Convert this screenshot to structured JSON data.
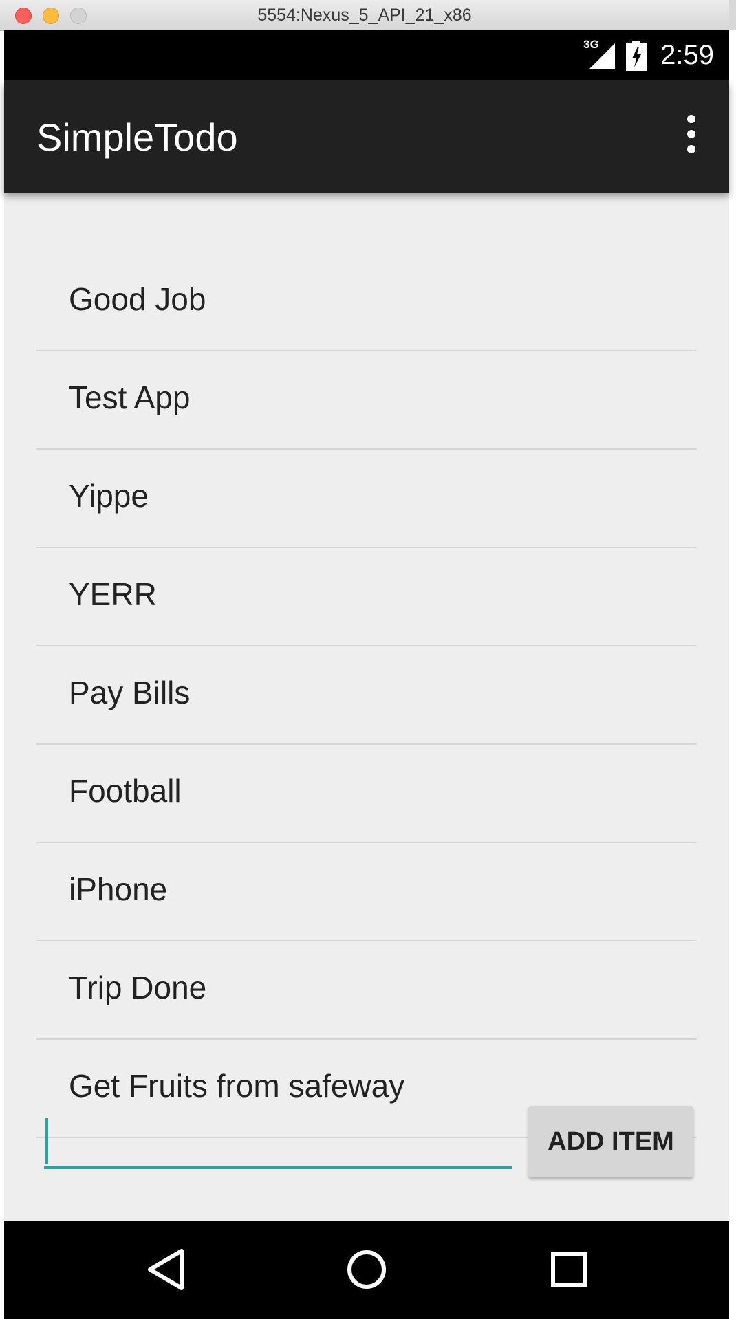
{
  "window": {
    "title": "5554:Nexus_5_API_21_x86"
  },
  "status_bar": {
    "network": "3G",
    "time": "2:59",
    "icons": [
      "signal-icon",
      "battery-charging-icon"
    ]
  },
  "app_bar": {
    "title": "SimpleTodo",
    "menu_icon": "overflow-menu-icon"
  },
  "todo_items": [
    {
      "label": "Good Job"
    },
    {
      "label": "Test App"
    },
    {
      "label": "Yippe"
    },
    {
      "label": "YERR"
    },
    {
      "label": "Pay Bills"
    },
    {
      "label": "Football"
    },
    {
      "label": "iPhone"
    },
    {
      "label": "Trip Done"
    },
    {
      "label": "Get Fruits from safeway"
    }
  ],
  "input": {
    "value": "",
    "placeholder": ""
  },
  "add_button": {
    "label": "ADD ITEM"
  },
  "nav_bar": {
    "icons": [
      "back-icon",
      "home-icon",
      "recents-icon"
    ]
  },
  "colors": {
    "app_bar": "#212121",
    "accent": "#26a69a",
    "background": "#eeeeee",
    "button": "#d6d6d6"
  }
}
